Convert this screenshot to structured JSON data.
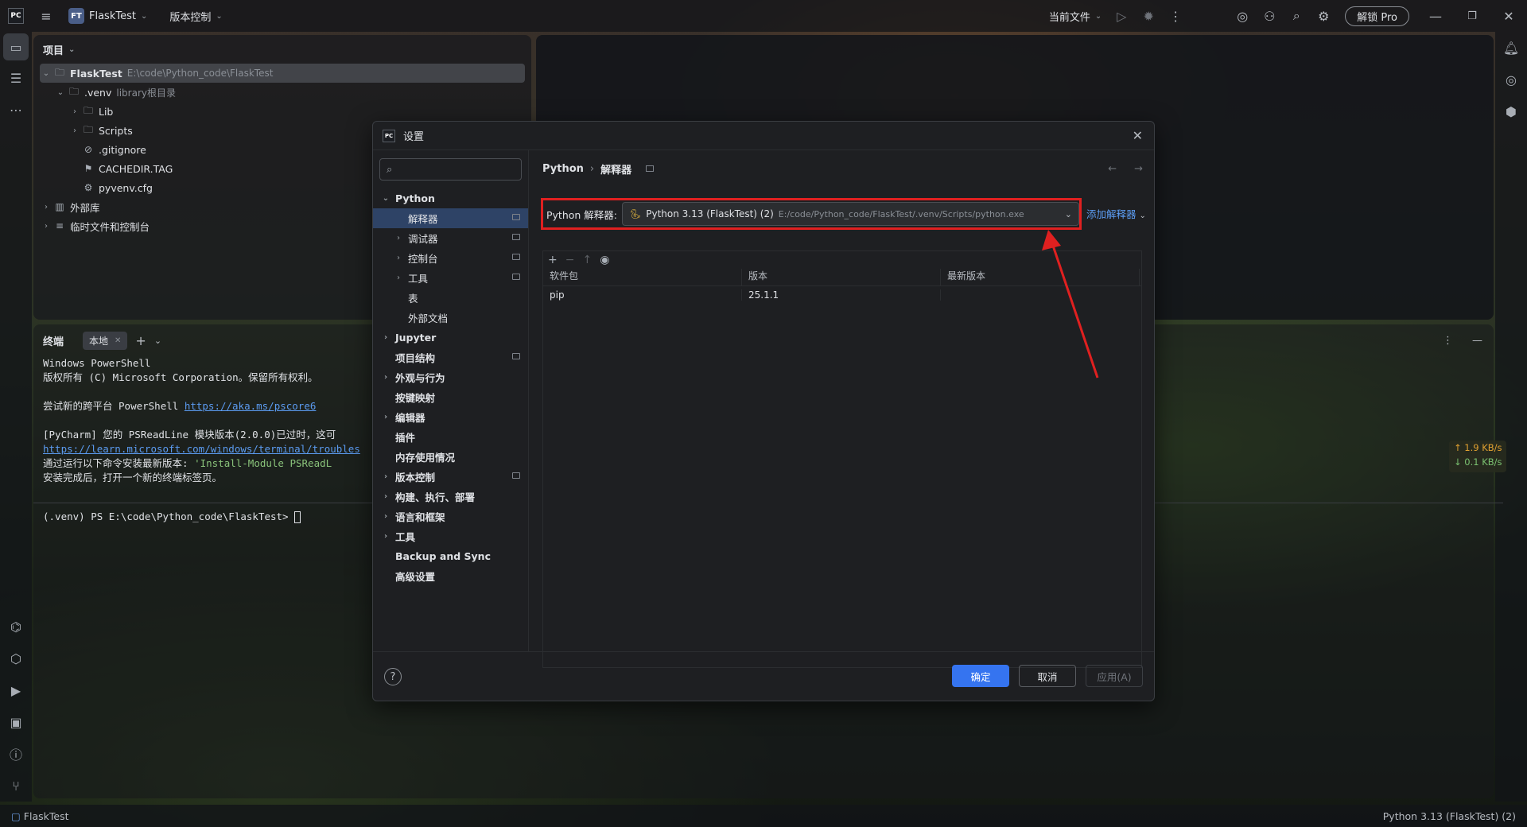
{
  "topbar": {
    "logo": "PC",
    "project_badge": "FT",
    "project_name": "FlaskTest",
    "vcs_menu": "版本控制",
    "run_config": "当前文件",
    "unlock_pro": "解锁 Pro"
  },
  "project_panel": {
    "title": "项目",
    "tree": [
      {
        "label": "FlaskTest",
        "hint": "E:\\code\\Python_code\\FlaskTest",
        "level": 0,
        "expanded": true,
        "icon": "folder-icon",
        "selected": true,
        "bold": true
      },
      {
        "label": ".venv",
        "hint": "library根目录",
        "level": 1,
        "expanded": true,
        "icon": "folder-icon"
      },
      {
        "label": "Lib",
        "hint": "",
        "level": 2,
        "expanded": false,
        "icon": "folder-icon"
      },
      {
        "label": "Scripts",
        "hint": "",
        "level": 2,
        "expanded": false,
        "icon": "folder-icon"
      },
      {
        "label": ".gitignore",
        "hint": "",
        "level": 2,
        "icon": "ignore-file-icon"
      },
      {
        "label": "CACHEDIR.TAG",
        "hint": "",
        "level": 2,
        "icon": "tag-file-icon"
      },
      {
        "label": "pyvenv.cfg",
        "hint": "",
        "level": 2,
        "icon": "config-file-icon"
      },
      {
        "label": "外部库",
        "hint": "",
        "level": 0,
        "expanded": false,
        "icon": "library-icon"
      },
      {
        "label": "临时文件和控制台",
        "hint": "",
        "level": 0,
        "expanded": false,
        "icon": "scratch-icon"
      }
    ]
  },
  "terminal": {
    "title": "终端",
    "tab": "本地",
    "lines": [
      {
        "text": "Windows PowerShell"
      },
      {
        "text": "版权所有 (C) Microsoft Corporation。保留所有权利。"
      },
      {
        "text": ""
      },
      {
        "text": "尝试新的跨平台 PowerShell ",
        "link": "https://aka.ms/pscore6"
      },
      {
        "text": ""
      },
      {
        "text": "[PyCharm] 您的 PSReadLine 模块版本(2.0.0)已过时，这可"
      },
      {
        "text": "",
        "link": "https://learn.microsoft.com/windows/terminal/troubles"
      },
      {
        "text": "通过运行以下命令安装最新版本: ",
        "green": "'Install-Module PSReadL"
      },
      {
        "text": "安装完成后，打开一个新的终端标签页。"
      },
      {
        "text": ""
      }
    ],
    "prompt": "(.venv) PS E:\\code\\Python_code\\FlaskTest> "
  },
  "netspeed": {
    "up": "↑ 1.9 KB/s",
    "down": "↓ 0.1 KB/s",
    "up_color": "#e0a030",
    "down_color": "#7ac070"
  },
  "statusbar": {
    "left": "FlaskTest",
    "right": "Python 3.13 (FlaskTest) (2)"
  },
  "dialog": {
    "title": "设置",
    "search_placeholder": "",
    "nav": [
      {
        "label": "Python",
        "level": 0,
        "expanded": true,
        "bold": true
      },
      {
        "label": "解释器",
        "level": 1,
        "selected": true,
        "pin": true
      },
      {
        "label": "调试器",
        "level": 1,
        "arrow": true,
        "pin": true
      },
      {
        "label": "控制台",
        "level": 1,
        "arrow": true,
        "pin": true
      },
      {
        "label": "工具",
        "level": 1,
        "arrow": true,
        "pin": true
      },
      {
        "label": "表",
        "level": 1
      },
      {
        "label": "外部文档",
        "level": 1
      },
      {
        "label": "Jupyter",
        "level": 0,
        "arrow": true,
        "bold": true
      },
      {
        "label": "项目结构",
        "level": 0,
        "pin": true,
        "bold": true
      },
      {
        "label": "外观与行为",
        "level": 0,
        "arrow": true,
        "bold": true
      },
      {
        "label": "按键映射",
        "level": 0,
        "bold": true
      },
      {
        "label": "编辑器",
        "level": 0,
        "arrow": true,
        "bold": true
      },
      {
        "label": "插件",
        "level": 0,
        "bold": true
      },
      {
        "label": "内存使用情况",
        "level": 0,
        "bold": true
      },
      {
        "label": "版本控制",
        "level": 0,
        "arrow": true,
        "pin": true,
        "bold": true
      },
      {
        "label": "构建、执行、部署",
        "level": 0,
        "arrow": true,
        "bold": true
      },
      {
        "label": "语言和框架",
        "level": 0,
        "arrow": true,
        "bold": true
      },
      {
        "label": "工具",
        "level": 0,
        "arrow": true,
        "bold": true
      },
      {
        "label": "Backup and Sync",
        "level": 0,
        "bold": true
      },
      {
        "label": "高级设置",
        "level": 0,
        "bold": true
      }
    ],
    "breadcrumb": [
      "Python",
      "解释器"
    ],
    "interpreter_label": "Python 解释器:",
    "interpreter_name": "Python 3.13 (FlaskTest) (2)",
    "interpreter_path": "E:/code/Python_code/FlaskTest/.venv/Scripts/python.exe",
    "add_interpreter": "添加解释器",
    "columns": [
      "软件包",
      "版本",
      "最新版本"
    ],
    "packages": [
      {
        "name": "pip",
        "version": "25.1.1",
        "latest": ""
      }
    ],
    "ok": "确定",
    "cancel": "取消",
    "apply": "应用(A)",
    "help": "?"
  },
  "colors": {
    "annotation": "#e02020",
    "accent": "#3574f0"
  }
}
